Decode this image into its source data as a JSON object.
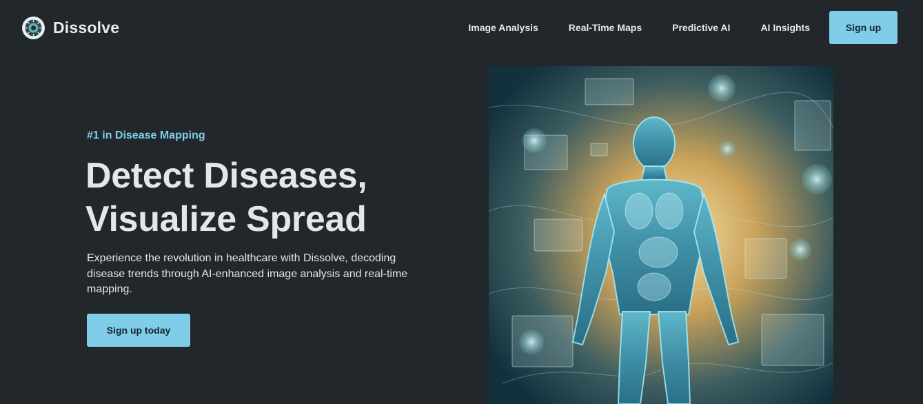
{
  "brand": {
    "name": "Dissolve",
    "logo_icon": "virus-globe-icon"
  },
  "nav": {
    "links": [
      "Image Analysis",
      "Real-Time Maps",
      "Predictive AI",
      "AI Insights"
    ],
    "signup_label": "Sign up"
  },
  "hero": {
    "eyebrow": "#1 in Disease Mapping",
    "headline_line1": "Detect Diseases,",
    "headline_line2": "Visualize Spread",
    "description": "Experience the revolution in healthcare with Dissolve, decoding disease trends through AI-enhanced image analysis and real-time mapping.",
    "cta_label": "Sign up today",
    "image_subject": "glowing-human-body-hologram"
  },
  "colors": {
    "background": "#22272b",
    "accent": "#7fcde8",
    "text": "#e4e6e8"
  }
}
